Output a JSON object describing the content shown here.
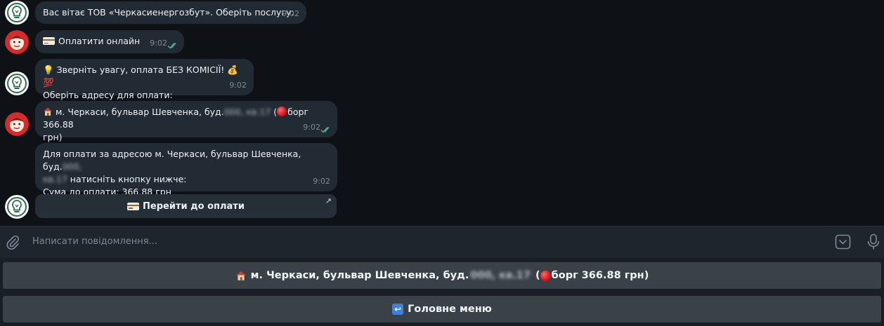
{
  "messages": [
    {
      "id": "m1",
      "text": "Вас вітає ТОВ «Черкасиенергозбут». Оберіть послугу:",
      "time": "9:02"
    },
    {
      "id": "m2",
      "text": "Оплатити онлайн",
      "time": "9:02"
    },
    {
      "id": "m3",
      "line1": "Зверніть увагу, оплата БЕЗ КОМІСІЇ!",
      "line2": "Оберіть адресу для оплати:",
      "time": "9:02"
    },
    {
      "id": "m4",
      "addr": "м. Черкаси, бульвар Шевченка, буд.",
      "hidden": "000, кв.17",
      "debt": "борг 366.88",
      "tail": "грн)",
      "time": "9:02"
    },
    {
      "id": "m5",
      "line1": "Для оплати за адресою м. Черкаси, бульвар Шевченка, буд.",
      "hidden1": "000,",
      "hidden2": "кв.17",
      "line2": "натисніть кнопку нижче:",
      "line3": "Сума до оплати: 366.88 грн",
      "time": "9:02"
    }
  ],
  "inline_button": {
    "label": "Перейти до оплати"
  },
  "composer": {
    "placeholder": "Написати повідомлення..."
  },
  "keyboard": {
    "address_prefix": "м. Черкаси, бульвар Шевченка, буд.",
    "address_hidden": "000, кв.17",
    "address_debt": "борг 366.88 грн)",
    "main_menu": "Головне меню"
  }
}
